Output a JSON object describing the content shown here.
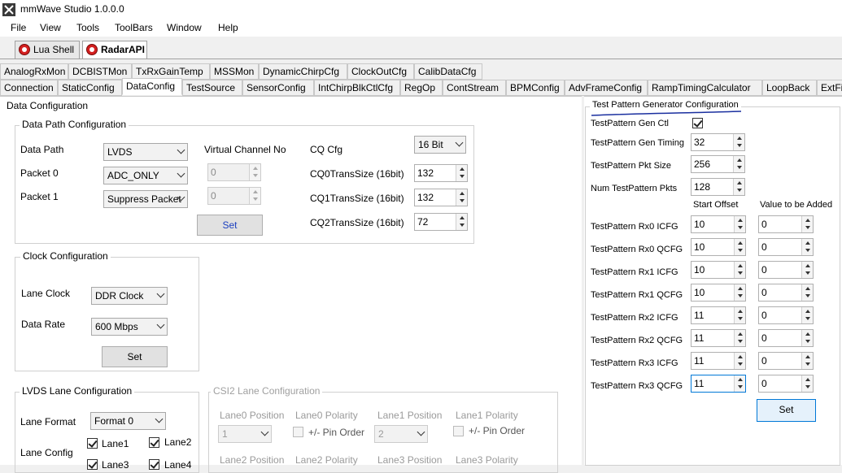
{
  "window": {
    "title": "mmWave Studio 1.0.0.0"
  },
  "menu": [
    "File",
    "View",
    "Tools",
    "ToolBars",
    "Window",
    "Help"
  ],
  "tool_tabs": [
    {
      "label": "Lua Shell",
      "active": false
    },
    {
      "label": "RadarAPI",
      "active": true
    }
  ],
  "tabs_row1": [
    "AnalogRxMon",
    "DCBISTMon",
    "TxRxGainTemp",
    "MSSMon",
    "DynamicChirpCfg",
    "ClockOutCfg",
    "CalibDataCfg"
  ],
  "tabs_row2": [
    "Connection",
    "StaticConfig",
    "DataConfig",
    "TestSource",
    "SensorConfig",
    "IntChirpBlkCtlCfg",
    "RegOp",
    "ContStream",
    "BPMConfig",
    "AdvFrameConfig",
    "RampTimingCalculator",
    "LoopBack",
    "ExtFi"
  ],
  "active_tab": "DataConfig",
  "data_config": {
    "title": "Data Configuration",
    "data_path": {
      "title": "Data Path Configuration",
      "data_path_label": "Data Path",
      "data_path_value": "LVDS",
      "packet0_label": "Packet 0",
      "packet0_value": "ADC_ONLY",
      "packet1_label": "Packet 1",
      "packet1_value": "Suppress Packet",
      "vc_label": "Virtual Channel No",
      "vc0_value": "0",
      "vc1_value": "0",
      "cq_cfg_label": "CQ Cfg",
      "cq_cfg_value": "16 Bit",
      "cq0_label": "CQ0TransSize (16bit)",
      "cq0_value": "132",
      "cq1_label": "CQ1TransSize (16bit)",
      "cq1_value": "132",
      "cq2_label": "CQ2TransSize (16bit)",
      "cq2_value": "72",
      "set_label": "Set"
    },
    "clock": {
      "title": "Clock Configuration",
      "lane_clock_label": "Lane Clock",
      "lane_clock_value": "DDR Clock",
      "data_rate_label": "Data Rate",
      "data_rate_value": "600 Mbps",
      "set_label": "Set"
    },
    "lvds": {
      "title": "LVDS Lane Configuration",
      "lane_format_label": "Lane Format",
      "lane_format_value": "Format 0",
      "lane_config_label": "Lane Config",
      "lanes": [
        {
          "label": "Lane1",
          "checked": true
        },
        {
          "label": "Lane2",
          "checked": true
        },
        {
          "label": "Lane3",
          "checked": true
        },
        {
          "label": "Lane4",
          "checked": true
        }
      ]
    },
    "csi2": {
      "title": "CSI2 Lane Configuration",
      "lane0_position_label": "Lane0 Position",
      "lane0_polarity_label": "Lane0 Polarity",
      "lane1_position_label": "Lane1 Position",
      "lane1_polarity_label": "Lane1 Polarity",
      "lane0_position_value": "1",
      "lane1_position_value": "2",
      "pin_order_label": "+/- Pin Order",
      "lane2_position_label": "Lane2 Position",
      "lane2_polarity_label": "Lane2 Polarity",
      "lane3_position_label": "Lane3 Position",
      "lane3_polarity_label": "Lane3 Polarity"
    }
  },
  "test_pattern": {
    "title": "Test Pattern Generator Configuration",
    "gen_ctl_label": "TestPattern Gen Ctl",
    "gen_ctl_checked": true,
    "gen_timing_label": "TestPattern Gen Timing",
    "gen_timing_value": "32",
    "pkt_size_label": "TestPattern Pkt Size",
    "pkt_size_value": "256",
    "num_pkts_label": "Num TestPattern Pkts",
    "num_pkts_value": "128",
    "start_offset_header": "Start Offset",
    "value_added_header": "Value to be Added",
    "rows": [
      {
        "label": "TestPattern Rx0 ICFG",
        "offset": "10",
        "add": "0"
      },
      {
        "label": "TestPattern Rx0 QCFG",
        "offset": "10",
        "add": "0"
      },
      {
        "label": "TestPattern Rx1 ICFG",
        "offset": "10",
        "add": "0"
      },
      {
        "label": "TestPattern Rx1 QCFG",
        "offset": "10",
        "add": "0"
      },
      {
        "label": "TestPattern Rx2 ICFG",
        "offset": "11",
        "add": "0"
      },
      {
        "label": "TestPattern Rx2 QCFG",
        "offset": "11",
        "add": "0"
      },
      {
        "label": "TestPattern Rx3 ICFG",
        "offset": "11",
        "add": "0"
      },
      {
        "label": "TestPattern Rx3 QCFG",
        "offset": "11",
        "add": "0"
      }
    ],
    "set_label": "Set"
  },
  "colors": {
    "accent_blue": "#1a3fbf",
    "focus_border": "#0078d7",
    "pen_underline": "#1a2f9f"
  }
}
